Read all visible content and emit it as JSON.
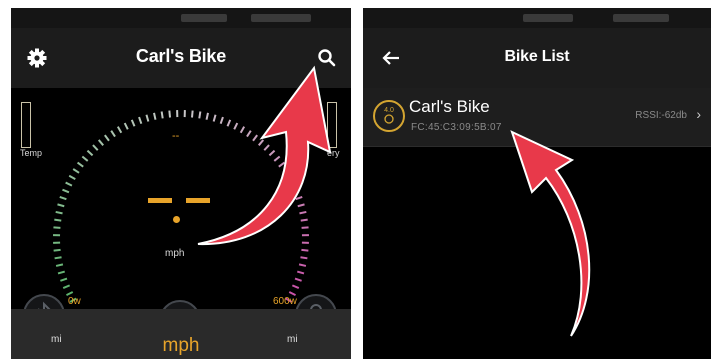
{
  "left": {
    "header": {
      "title": "Carl's Bike"
    },
    "gauge": {
      "left_label": "Temp",
      "right_label": "ery",
      "small_dash": "--",
      "unit": "mph",
      "min_label": "0w",
      "max_label": "600w"
    },
    "bottom": {
      "left_dist": "mi",
      "right_dist": "mi",
      "unit": "mph"
    }
  },
  "right": {
    "header": {
      "title": "Bike List"
    },
    "device": {
      "name": "Carl's Bike",
      "address": "FC:45:C3:09:5B:07",
      "rssi": "RSSI:-62db",
      "icon_text": "4.0"
    }
  },
  "colors": {
    "accent": "#e8a42a",
    "arrow": "#e8394a",
    "arc_low": "#5ab36b",
    "arc_high": "#c94fa8"
  },
  "icons": {
    "settings": "gear-icon",
    "search": "search-icon",
    "back": "back-arrow-icon",
    "bluetooth": "bluetooth-icon",
    "speed": "speed-gauge-icon",
    "lock": "lock-icon",
    "chevron": "chevron-right-icon"
  }
}
